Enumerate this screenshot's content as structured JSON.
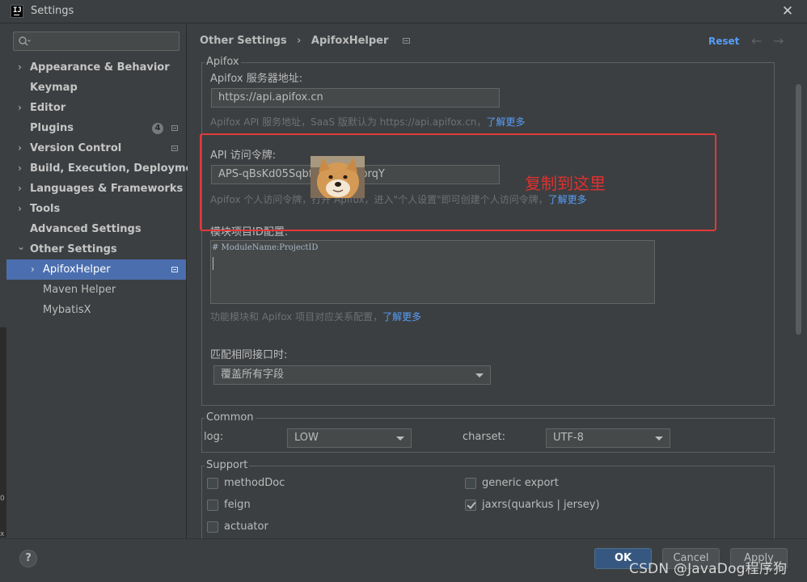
{
  "window": {
    "title": "Settings"
  },
  "sidebar": {
    "search_placeholder": "",
    "items": [
      {
        "label": "Appearance & Behavior",
        "chevron": "›",
        "bold": true
      },
      {
        "label": "Keymap",
        "chevron": "",
        "bold": true
      },
      {
        "label": "Editor",
        "chevron": "›",
        "bold": true
      },
      {
        "label": "Plugins",
        "chevron": "",
        "bold": true,
        "badge": "4"
      },
      {
        "label": "Version Control",
        "chevron": "›",
        "bold": true
      },
      {
        "label": "Build, Execution, Deployment",
        "chevron": "›",
        "bold": true
      },
      {
        "label": "Languages & Frameworks",
        "chevron": "›",
        "bold": true
      },
      {
        "label": "Tools",
        "chevron": "›",
        "bold": true
      },
      {
        "label": "Advanced Settings",
        "chevron": "",
        "bold": true
      },
      {
        "label": "Other Settings",
        "chevron": "⌄",
        "bold": true
      },
      {
        "label": "ApifoxHelper",
        "chevron": "›",
        "selected": true
      },
      {
        "label": "Maven Helper",
        "chevron": ""
      },
      {
        "label": "MybatisX",
        "chevron": ""
      }
    ]
  },
  "header": {
    "breadcrumb_parent": "Other Settings",
    "breadcrumb_sep": "›",
    "breadcrumb_current": "ApifoxHelper",
    "reset_label": "Reset",
    "back_arrow": "←",
    "forward_arrow": "→"
  },
  "apifox": {
    "group_title": "Apifox",
    "server_label": "Apifox 服务器地址:",
    "server_value": "https://api.apifox.cn",
    "server_hint": "Apifox API 服务地址，SaaS 版默认为 https://api.apifox.cn，",
    "server_hint_link": "了解更多",
    "token_label": "API 访问令牌:",
    "token_value": "APS-qBsKd05Sqbfh                    aD3lFObrqY",
    "token_hint": "Apifox 个人访问令牌，打开 Apifox，进入\"个人设置\"即可创建个人访问令牌，",
    "token_hint_link": "了解更多",
    "module_label": "模块项目ID配置:",
    "module_value": "# ModuleName:ProjectID",
    "module_hint": "功能模块和 Apifox 项目对应关系配置，",
    "module_hint_link": "了解更多",
    "match_label": "匹配相同接口时:",
    "match_value": "覆盖所有字段"
  },
  "annotation": {
    "text": "复制到这里",
    "color": "#e0302f"
  },
  "common": {
    "group_title": "Common",
    "log_label": "log:",
    "log_value": "LOW",
    "charset_label": "charset:",
    "charset_value": "UTF-8"
  },
  "support": {
    "group_title": "Support",
    "options": [
      {
        "label": "methodDoc",
        "checked": false
      },
      {
        "label": "generic export",
        "checked": false
      },
      {
        "label": "feign",
        "checked": false
      },
      {
        "label": "jaxrs(quarkus | jersey)",
        "checked": true
      },
      {
        "label": "actuator",
        "checked": false
      }
    ]
  },
  "footer": {
    "help_label": "?",
    "ok_label": "OK",
    "cancel_label": "Cancel",
    "apply_label": "Apply",
    "watermark": "CSDN @JavaDog程序狗"
  },
  "left_strip": {
    "char_1": "0",
    "char_2": "x"
  },
  "colors": {
    "accent": "#4b6eaf",
    "link": "#589df6",
    "annotation_red": "#e03a3a",
    "background": "#3c3f41"
  }
}
